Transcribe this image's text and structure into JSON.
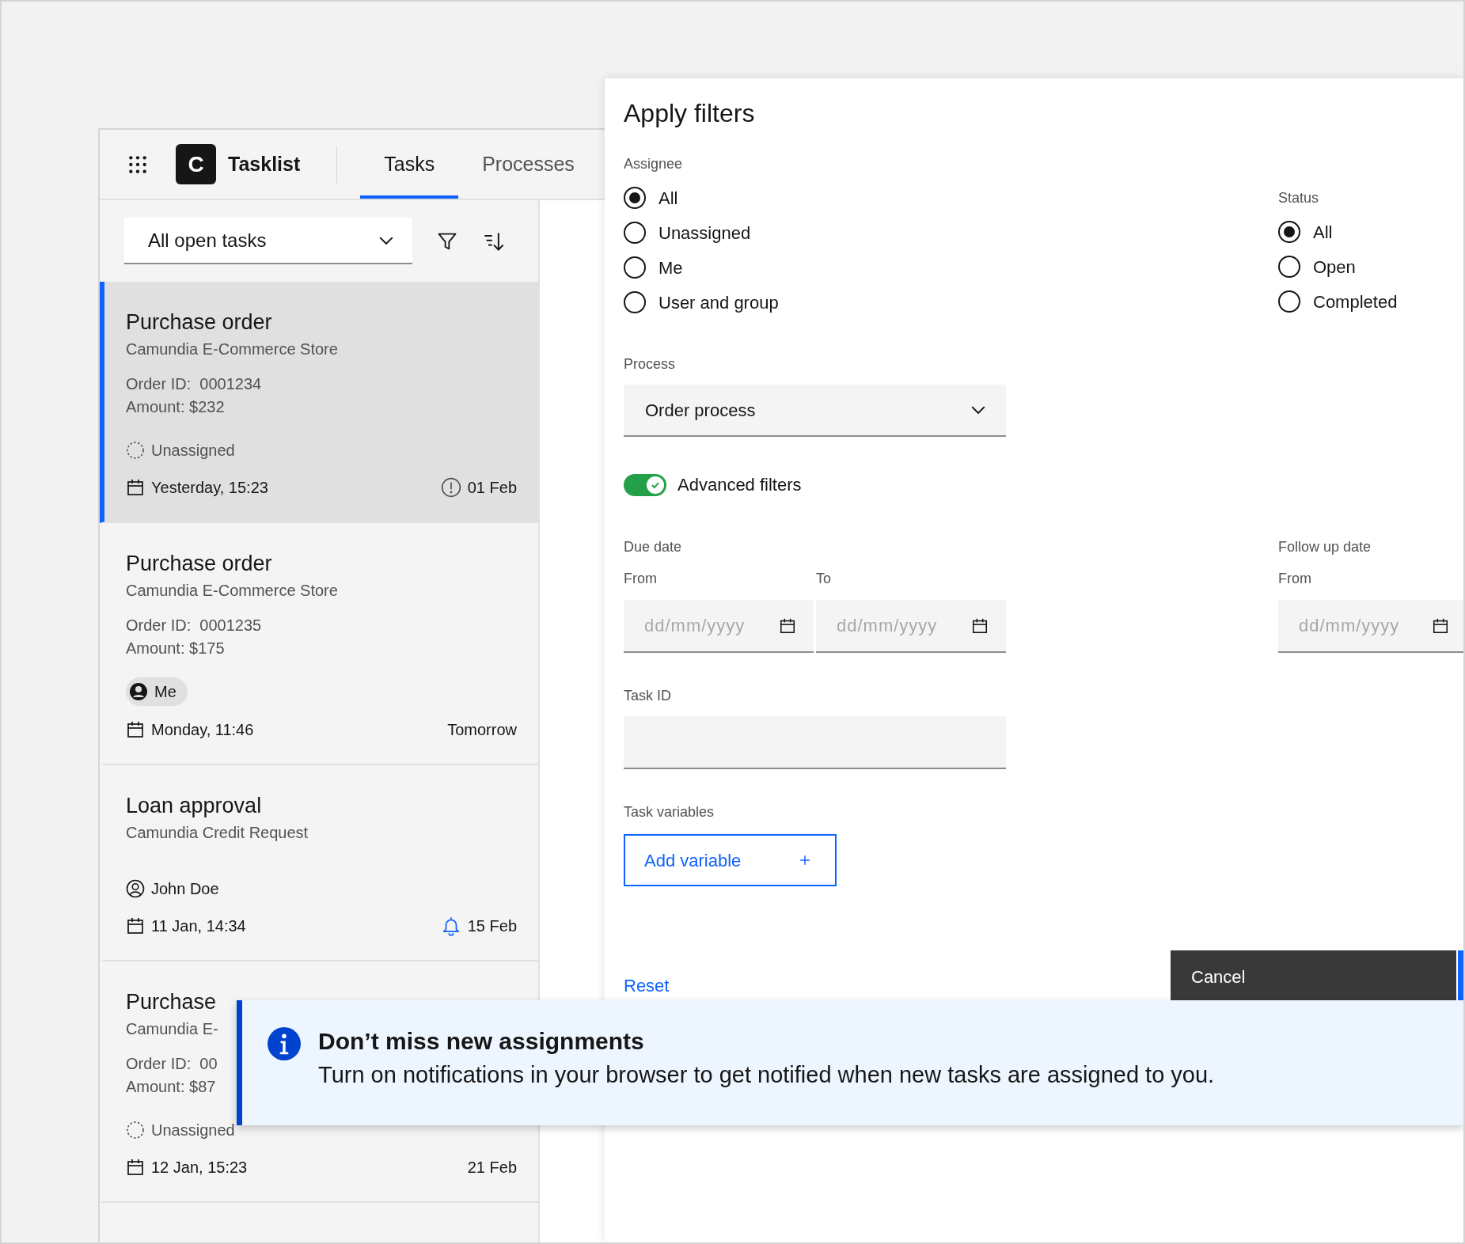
{
  "header": {
    "logo_letter": "C",
    "product": "Tasklist",
    "tabs": [
      {
        "label": "Tasks",
        "selected": true
      },
      {
        "label": "Processes",
        "selected": false
      }
    ]
  },
  "toolbar": {
    "filter_select": "All open tasks"
  },
  "tasks": [
    {
      "title": "Purchase order",
      "subtitle": "Camundia E-Commerce Store",
      "details": [
        "Order ID:  0001234",
        "Amount: $232"
      ],
      "assignee": {
        "kind": "unassigned",
        "label": "Unassigned"
      },
      "created": "Yesterday, 15:23",
      "due": {
        "kind": "overdue",
        "text": "01 Feb"
      },
      "selected": true
    },
    {
      "title": "Purchase order",
      "subtitle": "Camundia E-Commerce Store",
      "details": [
        "Order ID:  0001235",
        "Amount: $175"
      ],
      "assignee": {
        "kind": "me",
        "label": "Me"
      },
      "created": "Monday, 11:46",
      "due": {
        "kind": "plain",
        "text": "Tomorrow"
      },
      "selected": false
    },
    {
      "title": "Loan approval",
      "subtitle": "Camundia Credit Request",
      "assignee": {
        "kind": "user",
        "label": "John Doe"
      },
      "created": "11 Jan, 14:34",
      "due": {
        "kind": "reminder",
        "text": "15 Feb"
      },
      "selected": false
    },
    {
      "title": "Purchase",
      "subtitle": "Camundia E-",
      "details": [
        "Order ID:  00",
        "Amount: $87"
      ],
      "assignee": {
        "kind": "unassigned",
        "label": "Unassigned"
      },
      "created": "12 Jan, 15:23",
      "due": {
        "kind": "plain",
        "text": "21 Feb"
      },
      "selected": false
    }
  ],
  "filters": {
    "title": "Apply filters",
    "assignee": {
      "label": "Assignee",
      "options": [
        {
          "label": "All",
          "selected": true
        },
        {
          "label": "Unassigned",
          "selected": false
        },
        {
          "label": "Me",
          "selected": false
        },
        {
          "label": "User and group",
          "selected": false
        }
      ]
    },
    "status": {
      "label": "Status",
      "options": [
        {
          "label": "All",
          "selected": true
        },
        {
          "label": "Open",
          "selected": false
        },
        {
          "label": "Completed",
          "selected": false
        }
      ]
    },
    "process": {
      "label": "Process",
      "value": "Order process"
    },
    "advanced": {
      "label": "Advanced filters",
      "on": true
    },
    "due_date": {
      "label": "Due date",
      "fields": [
        {
          "label": "From",
          "placeholder": "dd/mm/yyyy"
        },
        {
          "label": "To",
          "placeholder": "dd/mm/yyyy"
        }
      ]
    },
    "follow_up_date": {
      "label": "Follow up date",
      "fields": [
        {
          "label": "From",
          "placeholder": "dd/mm/yyyy"
        }
      ]
    },
    "task_id": {
      "label": "Task ID"
    },
    "task_variables": {
      "label": "Task variables",
      "button": "Add variable"
    },
    "reset": "Reset",
    "cancel": "Cancel"
  },
  "notification": {
    "title": "Don’t miss new assignments",
    "message": "Turn on notifications in your browser to get notified when new tasks are assigned to you."
  }
}
